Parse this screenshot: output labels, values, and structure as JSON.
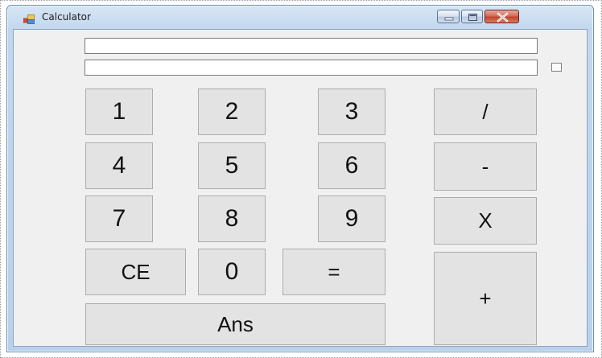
{
  "window": {
    "title": "Calculator",
    "icon": "windows-form-icon",
    "frame_color": "#b9d1ea",
    "close_button_color": "#c2462c"
  },
  "display": {
    "input_value": "",
    "result_value": "",
    "checkbox_checked": false
  },
  "keypad": {
    "one": "1",
    "two": "2",
    "three": "3",
    "divide": "/",
    "four": "4",
    "five": "5",
    "six": "6",
    "subtract": "-",
    "seven": "7",
    "eight": "8",
    "nine": "9",
    "multiply": "X",
    "clear": "CE",
    "zero": "0",
    "equals": "=",
    "add": "+",
    "answer": "Ans"
  }
}
